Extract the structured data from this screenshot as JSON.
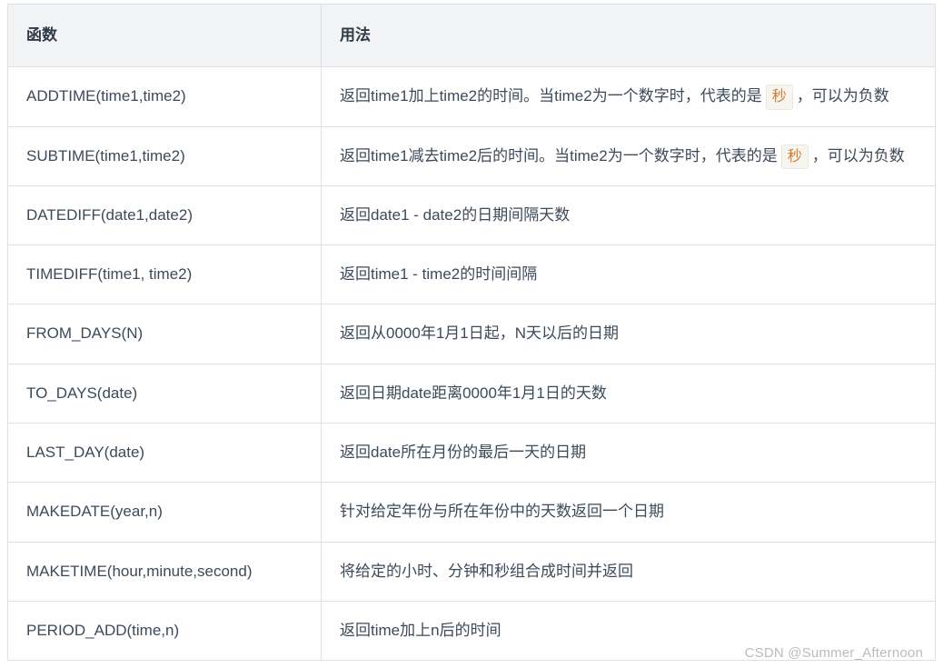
{
  "table": {
    "headers": [
      "函数",
      "用法"
    ],
    "rows": [
      {
        "fn": "ADDTIME(time1,time2)",
        "usage": {
          "pre": "返回time1加上time2的时间。当time2为一个数字时，代表的是",
          "pill": "秒",
          "post": "，可以为负数"
        }
      },
      {
        "fn": "SUBTIME(time1,time2)",
        "usage": {
          "pre": "返回time1减去time2后的时间。当time2为一个数字时，代表的是",
          "pill": "秒",
          "post": "，可以为负数"
        }
      },
      {
        "fn": "DATEDIFF(date1,date2)",
        "usage": "返回date1 - date2的日期间隔天数"
      },
      {
        "fn": "TIMEDIFF(time1, time2)",
        "usage": "返回time1 - time2的时间间隔"
      },
      {
        "fn": "FROM_DAYS(N)",
        "usage": "返回从0000年1月1日起，N天以后的日期"
      },
      {
        "fn": "TO_DAYS(date)",
        "usage": "返回日期date距离0000年1月1日的天数"
      },
      {
        "fn": "LAST_DAY(date)",
        "usage": "返回date所在月份的最后一天的日期"
      },
      {
        "fn": "MAKEDATE(year,n)",
        "usage": "针对给定年份与所在年份中的天数返回一个日期"
      },
      {
        "fn": "MAKETIME(hour,minute,second)",
        "usage": "将给定的小时、分钟和秒组合成时间并返回"
      },
      {
        "fn": "PERIOD_ADD(time,n)",
        "usage": "返回time加上n后的时间"
      }
    ]
  },
  "watermark": "CSDN @Summer_Afternoon"
}
